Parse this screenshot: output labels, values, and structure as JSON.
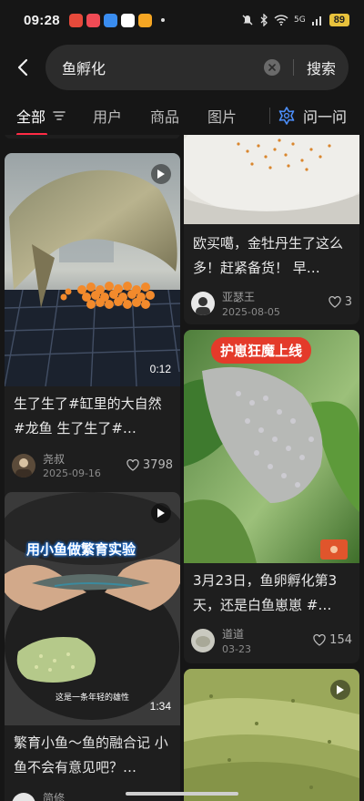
{
  "status": {
    "time": "09:28",
    "battery": "89",
    "network": "5G"
  },
  "search": {
    "query": "鱼孵化",
    "button": "搜索"
  },
  "tabs": [
    {
      "label": "全部"
    },
    {
      "label": "用户"
    },
    {
      "label": "商品"
    },
    {
      "label": "图片"
    }
  ],
  "ask_label": "问一问",
  "colors": {
    "accent": "#ff2b45",
    "background": "#161616",
    "card": "#1e1e1e"
  },
  "posts": [
    {
      "title": "生了生了#缸里的大自然 #龙鱼 生了生了#…",
      "author": "尧叔",
      "date": "2025-09-16",
      "likes": "3798",
      "duration": "0:12"
    },
    {
      "title": "欧买噶，金牡丹生了这么多！赶紧备货！ 早…",
      "author": "亚瑟王",
      "date": "2025-08-05",
      "likes": "3"
    },
    {
      "title": "3月23日，鱼卵孵化第3天，还是白鱼崽崽 #…",
      "author": "道道",
      "date": "03-23",
      "likes": "154",
      "banner": "护崽狂魔上线"
    },
    {
      "title": "繁育小鱼～鱼的融合记 小鱼不会有意见吧？…",
      "author": "简修",
      "duration": "1:34",
      "banner": "用小鱼做繁育实验",
      "caption": "这是一条年轻的雄性"
    }
  ]
}
